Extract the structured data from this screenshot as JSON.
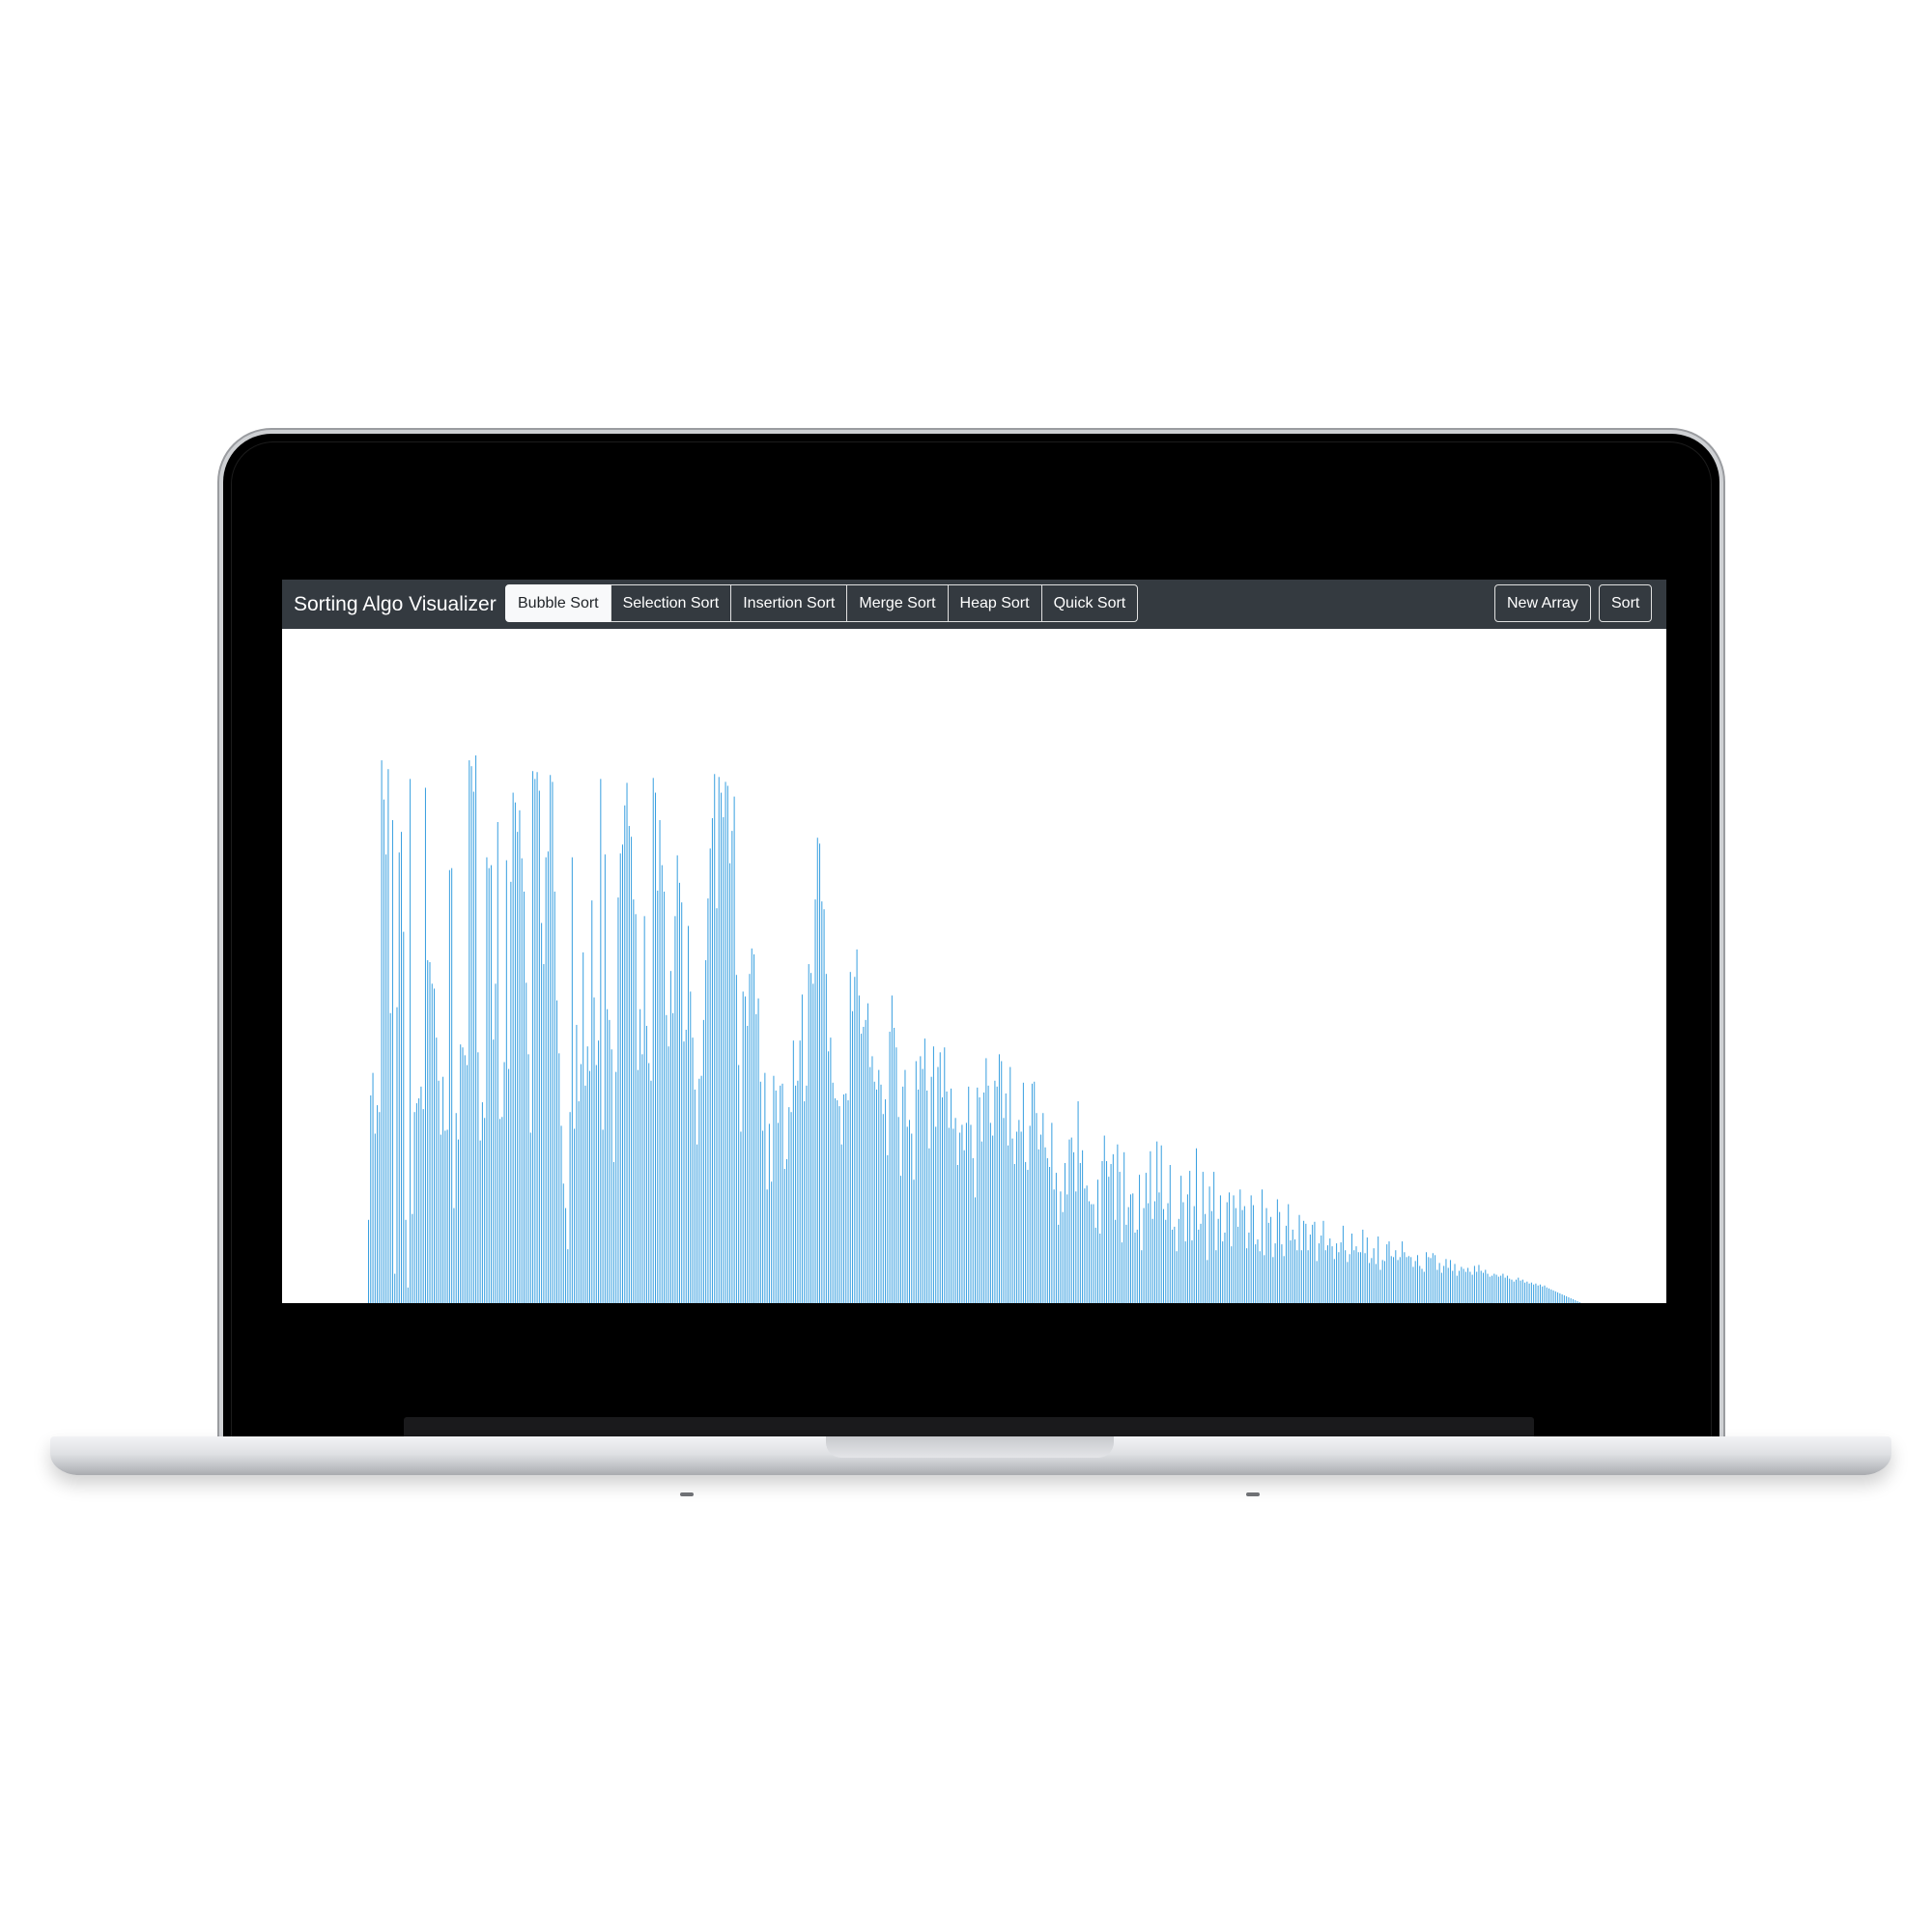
{
  "app": {
    "title": "Sorting Algo Visualizer"
  },
  "navbar": {
    "algorithms": [
      {
        "label": "Bubble Sort",
        "active": true
      },
      {
        "label": "Selection Sort",
        "active": false
      },
      {
        "label": "Insertion Sort",
        "active": false
      },
      {
        "label": "Merge Sort",
        "active": false
      },
      {
        "label": "Heap Sort",
        "active": false
      },
      {
        "label": "Quick Sort",
        "active": false
      }
    ],
    "new_array_label": "New Array",
    "sort_label": "Sort"
  },
  "colors": {
    "navbar_bg": "#343a40",
    "bar": "#3aa0e0",
    "active_button_bg": "#f8f9fa"
  },
  "chart_data": {
    "type": "bar",
    "grid": false,
    "ylim": [
      0,
      560
    ],
    "values": [
      85,
      212,
      235,
      173,
      202,
      195,
      554,
      514,
      458,
      545,
      296,
      493,
      30,
      302,
      460,
      481,
      379,
      85,
      16,
      535,
      91,
      195,
      204,
      209,
      221,
      198,
      526,
      350,
      348,
      326,
      321,
      271,
      227,
      172,
      231,
      176,
      177,
      442,
      444,
      97,
      194,
      167,
      264,
      261,
      253,
      243,
      554,
      548,
      522,
      559,
      256,
      166,
      205,
      189,
      455,
      444,
      447,
      269,
      326,
      491,
      188,
      190,
      246,
      452,
      239,
      430,
      521,
      511,
      481,
      503,
      454,
      420,
      327,
      254,
      174,
      543,
      535,
      542,
      523,
      388,
      346,
      455,
      461,
      539,
      532,
      420,
      309,
      255,
      181,
      122,
      97,
      55,
      195,
      455,
      178,
      284,
      206,
      244,
      358,
      222,
      262,
      237,
      411,
      312,
      243,
      268,
      535,
      177,
      458,
      300,
      289,
      259,
      144,
      236,
      414,
      459,
      468,
      508,
      531,
      487,
      476,
      412,
      397,
      238,
      300,
      254,
      395,
      283,
      245,
      227,
      536,
      521,
      421,
      493,
      447,
      420,
      294,
      262,
      339,
      296,
      395,
      457,
      429,
      409,
      267,
      279,
      385,
      318,
      271,
      218,
      162,
      229,
      232,
      289,
      350,
      413,
      464,
      495,
      540,
      403,
      537,
      521,
      496,
      532,
      528,
      449,
      482,
      517,
      335,
      243,
      175,
      318,
      313,
      283,
      336,
      362,
      356,
      295,
      311,
      226,
      176,
      235,
      116,
      183,
      124,
      232,
      217,
      184,
      222,
      224,
      137,
      147,
      200,
      195,
      268,
      222,
      227,
      268,
      315,
      206,
      222,
      346,
      337,
      326,
      412,
      475,
      469,
      410,
      402,
      336,
      257,
      271,
      225,
      209,
      207,
      201,
      162,
      213,
      214,
      207,
      338,
      298,
      333,
      361,
      314,
      275,
      282,
      289,
      306,
      241,
      252,
      226,
      218,
      238,
      223,
      193,
      208,
      151,
      277,
      314,
      281,
      261,
      190,
      130,
      221,
      238,
      180,
      187,
      173,
      126,
      247,
      218,
      252,
      239,
      270,
      217,
      158,
      231,
      262,
      180,
      241,
      256,
      210,
      261,
      216,
      179,
      219,
      178,
      189,
      141,
      174,
      182,
      156,
      184,
      221,
      182,
      148,
      108,
      220,
      210,
      165,
      215,
      250,
      222,
      184,
      171,
      227,
      221,
      254,
      247,
      189,
      214,
      161,
      241,
      168,
      142,
      175,
      187,
      175,
      225,
      144,
      136,
      181,
      224,
      226,
      194,
      157,
      172,
      194,
      159,
      148,
      139,
      184,
      116,
      133,
      80,
      114,
      93,
      143,
      111,
      167,
      169,
      154,
      114,
      206,
      143,
      156,
      117,
      120,
      104,
      101,
      101,
      77,
      126,
      71,
      145,
      171,
      145,
      129,
      142,
      152,
      85,
      162,
      134,
      62,
      154,
      80,
      98,
      111,
      112,
      72,
      75,
      131,
      54,
      97,
      133,
      102,
      155,
      86,
      104,
      165,
      113,
      161,
      96,
      85,
      102,
      141,
      75,
      78,
      53,
      86,
      130,
      103,
      63,
      111,
      135,
      64,
      99,
      158,
      75,
      81,
      134,
      91,
      44,
      119,
      94,
      134,
      54,
      86,
      110,
      63,
      72,
      103,
      113,
      58,
      110,
      97,
      78,
      116,
      95,
      99,
      56,
      72,
      110,
      100,
      60,
      65,
      53,
      116,
      49,
      97,
      82,
      88,
      47,
      61,
      106,
      93,
      60,
      48,
      79,
      101,
      64,
      75,
      65,
      54,
      90,
      54,
      84,
      81,
      54,
      70,
      80,
      83,
      43,
      61,
      69,
      84,
      54,
      59,
      66,
      58,
      45,
      61,
      52,
      62,
      79,
      54,
      42,
      50,
      71,
      54,
      58,
      52,
      52,
      75,
      51,
      67,
      41,
      46,
      56,
      40,
      68,
      34,
      44,
      43,
      60,
      63,
      48,
      47,
      54,
      44,
      47,
      63,
      52,
      47,
      48,
      47,
      37,
      43,
      49,
      38,
      35,
      32,
      52,
      47,
      46,
      51,
      49,
      34,
      41,
      31,
      38,
      45,
      36,
      44,
      33,
      40,
      28,
      33,
      37,
      35,
      32,
      36,
      32,
      29,
      38,
      32,
      39,
      33,
      31,
      34,
      30,
      27,
      28,
      30,
      29,
      27,
      28,
      30,
      26,
      28,
      25,
      24,
      22,
      24,
      26,
      23,
      24,
      21,
      22,
      20,
      21,
      19,
      20,
      18,
      19,
      17,
      18,
      16,
      15,
      14,
      13,
      12,
      11,
      10,
      9,
      8,
      7,
      6,
      5,
      4,
      3,
      2,
      1
    ]
  }
}
